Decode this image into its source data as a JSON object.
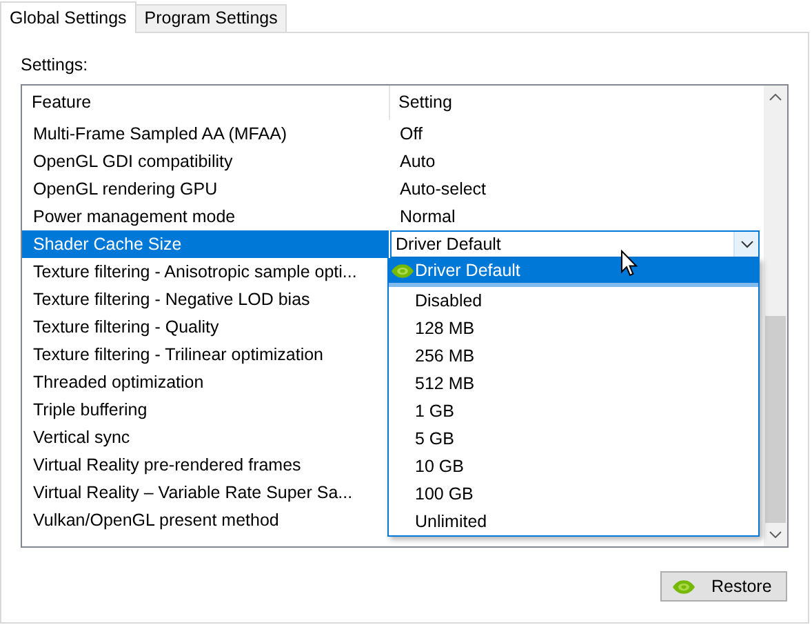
{
  "tabs": [
    {
      "label": "Global Settings",
      "selected": true
    },
    {
      "label": "Program Settings",
      "selected": false
    }
  ],
  "section_label": "Settings:",
  "table": {
    "columns": [
      "Feature",
      "Setting"
    ],
    "rows": [
      {
        "feature": "Multi-Frame Sampled AA (MFAA)",
        "setting": "Off",
        "selected": false
      },
      {
        "feature": "OpenGL GDI compatibility",
        "setting": "Auto",
        "selected": false
      },
      {
        "feature": "OpenGL rendering GPU",
        "setting": "Auto-select",
        "selected": false
      },
      {
        "feature": "Power management mode",
        "setting": "Normal",
        "selected": false
      },
      {
        "feature": "Shader Cache Size",
        "selected": true
      },
      {
        "feature": "Texture filtering - Anisotropic sample opti...",
        "selected": false
      },
      {
        "feature": "Texture filtering - Negative LOD bias",
        "selected": false
      },
      {
        "feature": "Texture filtering - Quality",
        "selected": false
      },
      {
        "feature": "Texture filtering - Trilinear optimization",
        "selected": false
      },
      {
        "feature": "Threaded optimization",
        "selected": false
      },
      {
        "feature": "Triple buffering",
        "selected": false
      },
      {
        "feature": "Vertical sync",
        "selected": false
      },
      {
        "feature": "Virtual Reality pre-rendered frames",
        "selected": false
      },
      {
        "feature": "Virtual Reality – Variable Rate Super Sa...",
        "selected": false
      },
      {
        "feature": "Vulkan/OpenGL present method",
        "selected": false
      }
    ]
  },
  "dropdown": {
    "value": "Driver Default",
    "expanded": true,
    "options": [
      {
        "label": "Driver Default",
        "selected": true
      },
      {
        "label": "Disabled",
        "selected": false
      },
      {
        "label": "128 MB",
        "selected": false
      },
      {
        "label": "256 MB",
        "selected": false
      },
      {
        "label": "512 MB",
        "selected": false
      },
      {
        "label": "1 GB",
        "selected": false
      },
      {
        "label": "5 GB",
        "selected": false
      },
      {
        "label": "10 GB",
        "selected": false
      },
      {
        "label": "100 GB",
        "selected": false
      },
      {
        "label": "Unlimited",
        "selected": false
      }
    ]
  },
  "restore_button": "Restore"
}
